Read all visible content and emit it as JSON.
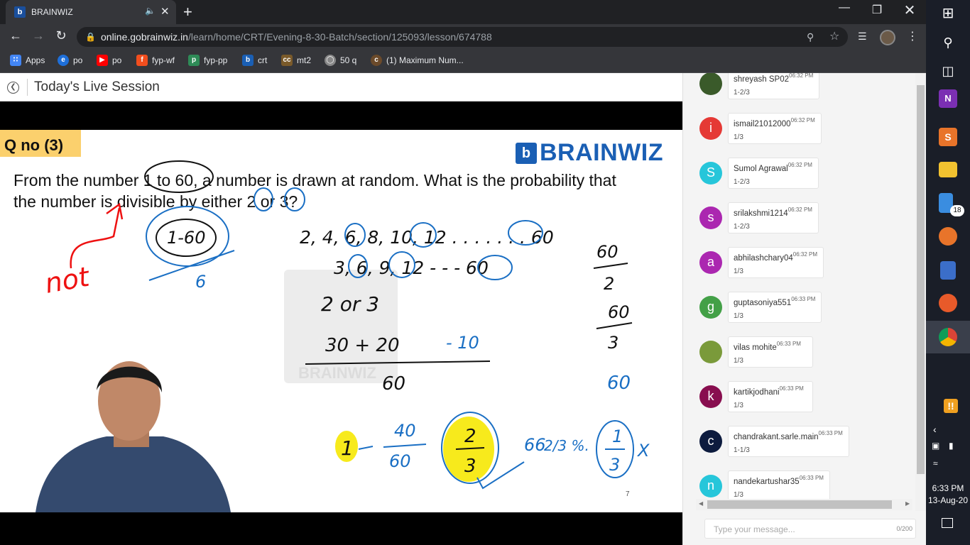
{
  "browser": {
    "tab_title": "BRAINWIZ",
    "tab_favicon": "b",
    "new_tab": "+",
    "url_host": "online.gobrainwiz.in",
    "url_path": "/learn/home/CRT/Evening-8-30-Batch/section/125093/lesson/674788",
    "bookmarks": [
      {
        "label": "Apps",
        "icon": "apps-grid-icon",
        "color": "#f4b400"
      },
      {
        "label": "po",
        "icon": "edge-icon",
        "color": "#1e6fd9"
      },
      {
        "label": "po",
        "icon": "youtube-icon",
        "color": "#ff0000"
      },
      {
        "label": "fyp-wf",
        "icon": "figma-icon",
        "color": "#f24e1e"
      },
      {
        "label": "fyp-pp",
        "icon": "pdf-icon",
        "color": "#2e8b57"
      },
      {
        "label": "crt",
        "icon": "brainwiz-icon",
        "color": "#1a5fb4"
      },
      {
        "label": "mt2",
        "icon": "cc-icon",
        "color": "#7a5a2a"
      },
      {
        "label": "50 q",
        "icon": "globe-icon",
        "color": "#888888"
      },
      {
        "label": "(1) Maximum Num...",
        "icon": "codechef-icon",
        "color": "#6b4a2a"
      }
    ]
  },
  "page": {
    "title": "Today's Live Session"
  },
  "slide": {
    "qno": "Q no (3)",
    "logo_text": "BRAINWIZ",
    "logo_mark": "b",
    "question_line1": "From the number 1 to 60, a number is drawn at random. What is the probability that",
    "question_line2": "the number is divisible by either 2 or 3?",
    "watermark": "BRAINWIZ",
    "page_number": "7",
    "handwriting": {
      "not": "not",
      "range": "1-60",
      "six": "6",
      "seq1": "2, 4, 6, 8, 10, 12 . . . . . . . 60",
      "seq2": "3, 6, 9, 12 - -  - 60",
      "two_or_three": "2  or  3",
      "sum": "30 + 20",
      "minus": "- 10",
      "den": "60",
      "r60a": "60",
      "r2": "2",
      "r60b": "60",
      "r3": "3",
      "r60c": "60",
      "one": "1",
      "frac40": "40",
      "frac60": "60",
      "ans_num": "2",
      "ans_den": "3",
      "pct": "66",
      "pct_frac": "2/3 %.",
      "alt_num": "1",
      "alt_den": "3",
      "cross": "X"
    }
  },
  "chat": {
    "messages": [
      {
        "name": "shreyash SP02",
        "time": "06:32 PM",
        "text": "1-2/3",
        "initial": "",
        "color": "#3a5a2a"
      },
      {
        "name": "ismail21012000",
        "time": "06:32 PM",
        "text": "1/3",
        "initial": "i",
        "color": "#e53935"
      },
      {
        "name": "Sumol Agrawal",
        "time": "06:32 PM",
        "text": "1-2/3",
        "initial": "S",
        "color": "#26c6da"
      },
      {
        "name": "srilakshmi1214",
        "time": "06:32 PM",
        "text": "1-2/3",
        "initial": "s",
        "color": "#ab27b0"
      },
      {
        "name": "abhilashchary04",
        "time": "06:32 PM",
        "text": "1/3",
        "initial": "a",
        "color": "#ab27b0"
      },
      {
        "name": "guptasoniya551",
        "time": "06:33 PM",
        "text": "1/3",
        "initial": "g",
        "color": "#43a047"
      },
      {
        "name": "vilas mohite",
        "time": "06:33 PM",
        "text": "1/3",
        "initial": "",
        "color": "#7a9a3a"
      },
      {
        "name": "kartikjodhani",
        "time": "06:33 PM",
        "text": "1/3",
        "initial": "k",
        "color": "#880e4f"
      },
      {
        "name": "chandrakant.sarle.main",
        "time": "06:33 PM",
        "text": "1-1/3",
        "initial": "c",
        "color": "#0d1b3e"
      },
      {
        "name": "nandekartushar35",
        "time": "06:33 PM",
        "text": "1/3",
        "initial": "n",
        "color": "#26c6da"
      }
    ],
    "input_placeholder": "Type your message...",
    "char_count": "0/200"
  },
  "taskbar": {
    "badge_count": "18",
    "time": "6:33 PM",
    "date": "13-Aug-20"
  }
}
